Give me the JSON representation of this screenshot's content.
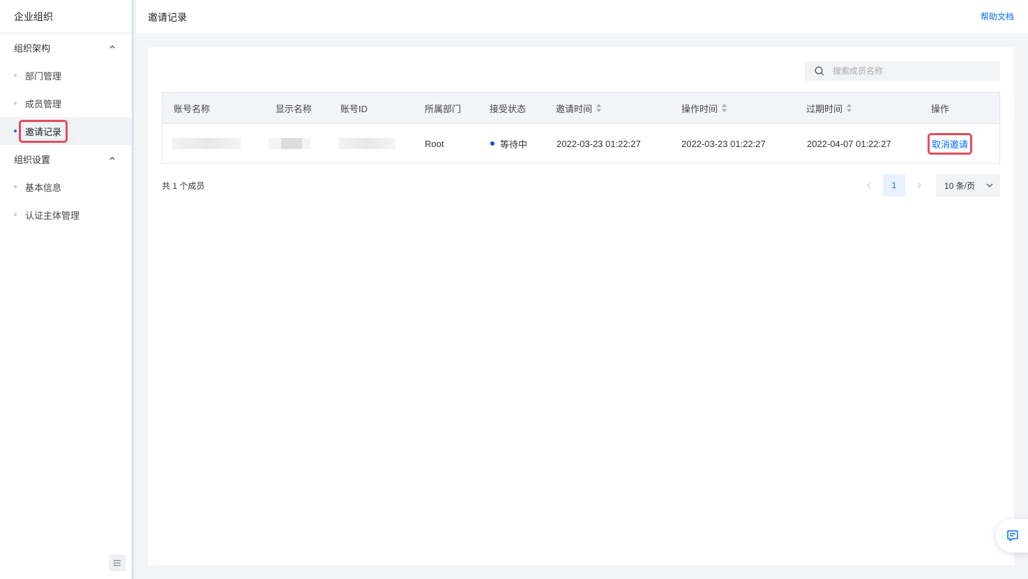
{
  "sidebar": {
    "title": "企业组织",
    "groups": [
      {
        "label": "组织架构",
        "items": [
          {
            "label": "部门管理"
          },
          {
            "label": "成员管理"
          },
          {
            "label": "邀请记录"
          }
        ]
      },
      {
        "label": "组织设置",
        "items": [
          {
            "label": "基本信息"
          },
          {
            "label": "认证主体管理"
          }
        ]
      }
    ],
    "active_item": "邀请记录"
  },
  "header": {
    "title": "邀请记录",
    "help_link": "帮助文档"
  },
  "search": {
    "placeholder": "搜索成员名称",
    "value": ""
  },
  "table": {
    "columns": [
      "账号名称",
      "显示名称",
      "账号ID",
      "所属部门",
      "接受状态",
      "邀请时间",
      "操作时间",
      "过期时间",
      "操作"
    ],
    "rows": [
      {
        "account_name": "",
        "display_name": "",
        "account_id": "",
        "department": "Root",
        "status": "等待中",
        "invite_time": "2022-03-23 01:22:27",
        "operate_time": "2022-03-23 01:22:27",
        "expire_time": "2022-04-07 01:22:27",
        "action": "取消邀请"
      }
    ]
  },
  "pagination": {
    "total_text": "共 1 个成员",
    "current_page": "1",
    "page_size": "10 条/页"
  },
  "colors": {
    "accent": "#006eff",
    "highlight_border": "#e34d59",
    "status_dot": "#0052d9"
  }
}
